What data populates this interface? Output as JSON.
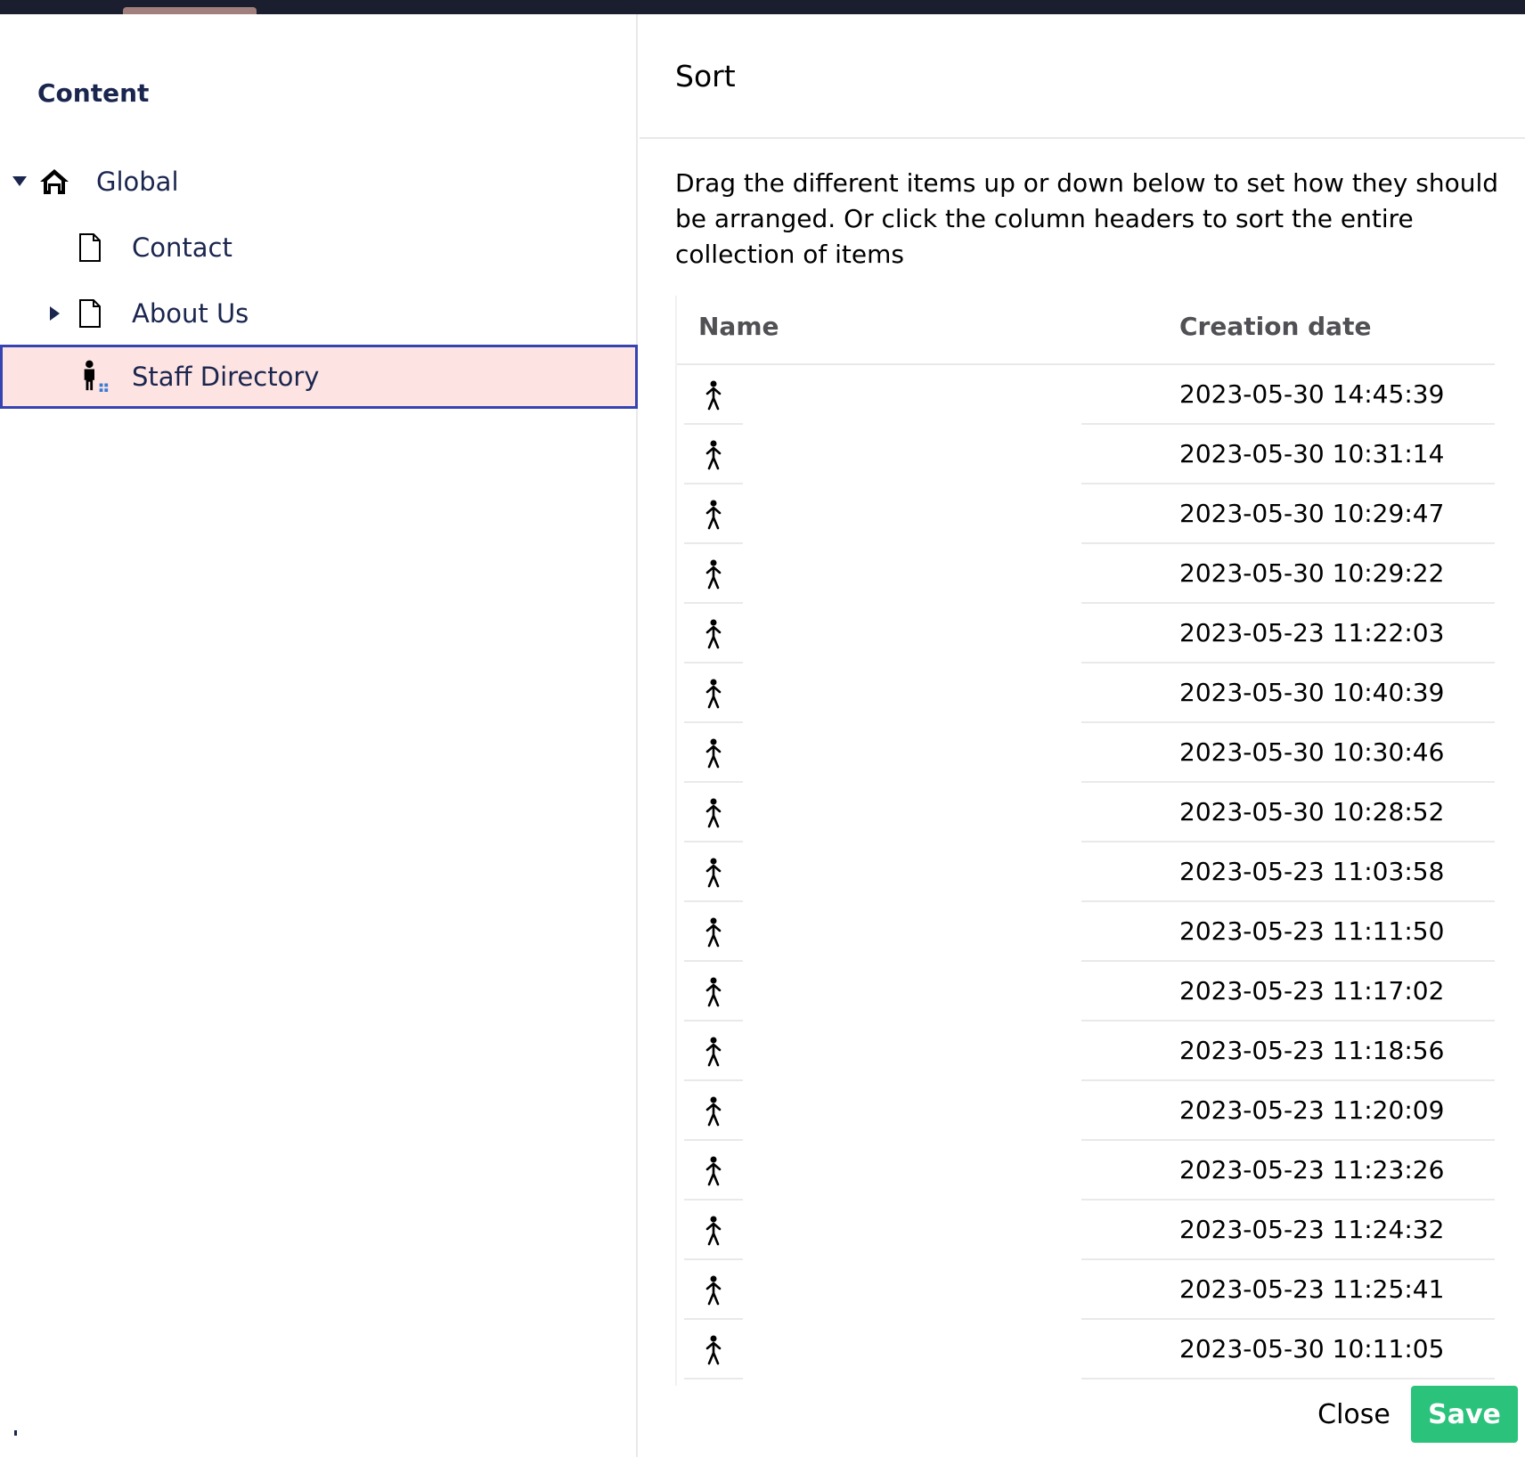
{
  "tree": {
    "title": "Content",
    "items": [
      {
        "label": "Global",
        "icon": "home-icon",
        "expanded": true
      },
      {
        "label": "Contact",
        "icon": "document-icon"
      },
      {
        "label": "About Us",
        "icon": "document-icon",
        "expanded": false
      },
      {
        "label": "Staff Directory",
        "icon": "person-list-icon",
        "selected": true
      }
    ]
  },
  "sort": {
    "title": "Sort",
    "description": "Drag the different items up or down below to set how they should be arranged. Or click the column headers to sort the entire collection of items",
    "columns": {
      "name": "Name",
      "creation_date": "Creation date"
    },
    "rows": [
      {
        "icon": "person-icon",
        "date": "2023-05-30 14:45:39"
      },
      {
        "icon": "person-icon",
        "date": "2023-05-30 10:31:14"
      },
      {
        "icon": "person-icon",
        "date": "2023-05-30 10:29:47"
      },
      {
        "icon": "person-icon",
        "date": "2023-05-30 10:29:22"
      },
      {
        "icon": "person-icon",
        "date": "2023-05-23 11:22:03"
      },
      {
        "icon": "person-icon",
        "date": "2023-05-30 10:40:39"
      },
      {
        "icon": "person-icon",
        "date": "2023-05-30 10:30:46"
      },
      {
        "icon": "person-icon",
        "date": "2023-05-30 10:28:52"
      },
      {
        "icon": "person-icon",
        "date": "2023-05-23 11:03:58"
      },
      {
        "icon": "person-icon",
        "date": "2023-05-23 11:11:50"
      },
      {
        "icon": "person-icon",
        "date": "2023-05-23 11:17:02"
      },
      {
        "icon": "person-icon",
        "date": "2023-05-23 11:18:56"
      },
      {
        "icon": "person-icon",
        "date": "2023-05-23 11:20:09"
      },
      {
        "icon": "person-icon",
        "date": "2023-05-23 11:23:26"
      },
      {
        "icon": "person-icon",
        "date": "2023-05-23 11:24:32"
      },
      {
        "icon": "person-icon",
        "date": "2023-05-23 11:25:41"
      },
      {
        "icon": "person-icon",
        "date": "2023-05-30 10:11:05"
      }
    ],
    "buttons": {
      "close": "Close",
      "save": "Save"
    }
  },
  "colors": {
    "accent": "#2bc37c",
    "navy": "#1b264f",
    "selected_bg": "#fde3e2",
    "selected_border": "#3544b1"
  }
}
